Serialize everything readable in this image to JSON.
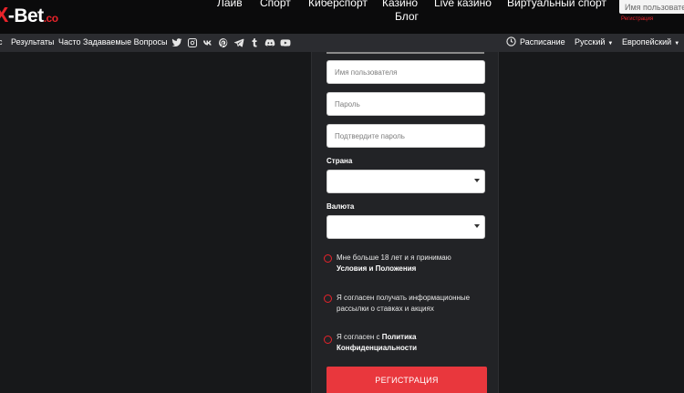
{
  "brand": {
    "x": "X",
    "name": "-Bet",
    "suffix": ".co"
  },
  "nav": {
    "live": "Лайв",
    "sport": "Спорт",
    "esport": "Киберспорт",
    "casino": "Казино",
    "blog": "Блог",
    "live_casino": "Live казино",
    "virtual_sport": "Виртуальный спорт"
  },
  "login": {
    "username_placeholder": "Имя пользователя",
    "register_link": "Регистрация"
  },
  "subnav": {
    "partial": "с",
    "results": "Результаты",
    "faq": "Часто Задаваемые Вопросы",
    "schedule": "Расписание",
    "language": "Русский",
    "odds_format": "Европейский"
  },
  "socials": [
    {
      "name": "twitter-icon",
      "glyph": "twitter"
    },
    {
      "name": "instagram-icon",
      "glyph": "instagram"
    },
    {
      "name": "vk-icon",
      "glyph": "vk"
    },
    {
      "name": "pinterest-icon",
      "glyph": "pinterest"
    },
    {
      "name": "telegram-icon",
      "glyph": "telegram"
    },
    {
      "name": "tumblr-icon",
      "glyph": "tumblr"
    },
    {
      "name": "discord-icon",
      "glyph": "discord"
    },
    {
      "name": "youtube-icon",
      "glyph": "youtube"
    }
  ],
  "form": {
    "username_placeholder": "Имя пользователя",
    "password_placeholder": "Пароль",
    "confirm_password_placeholder": "Подтвердите пароль",
    "country_label": "Страна",
    "currency_label": "Валюта",
    "age_text": "Мне больше 18 лет и я принимаю",
    "age_terms": "Условия и Положения",
    "newsletter_text": "Я согласен получать информационные рассылки о ставках и акциях",
    "privacy_text": "Я согласен с",
    "privacy_link": "Политика Конфиденциальности",
    "submit": "РЕГИСТРАЦИЯ"
  },
  "colors": {
    "accent": "#e8232a",
    "button": "#e9373d",
    "background": "#17181a",
    "panel": "#222326",
    "topbar": "#0b0b0c",
    "subbar": "#2b2c30"
  }
}
